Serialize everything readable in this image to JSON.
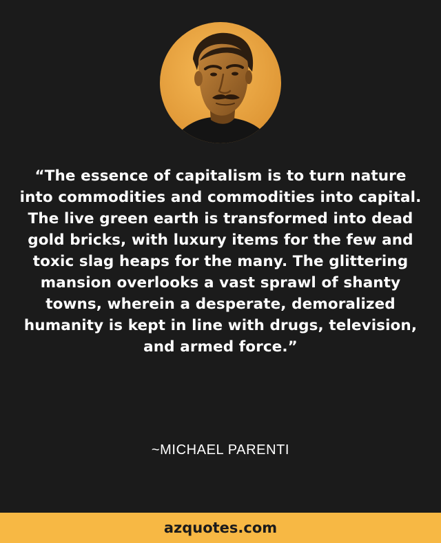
{
  "quote": {
    "text": "“The essence of capitalism is to turn nature into commodities and commodities into capital. The live green earth is transformed into dead gold bricks, with luxury items for the few and toxic slag heaps for the many. The glittering mansion overlooks a vast sprawl of shanty towns, wherein a desperate, demoralized humanity is kept in line with drugs, television, and armed force.”"
  },
  "author": {
    "name": "~MICHAEL PARENTI"
  },
  "footer": {
    "site": "azquotes.com"
  },
  "colors": {
    "background": "#1b1b1b",
    "accent": "#f7b844",
    "text": "#ffffff"
  },
  "portrait": {
    "icon": "author-portrait"
  }
}
